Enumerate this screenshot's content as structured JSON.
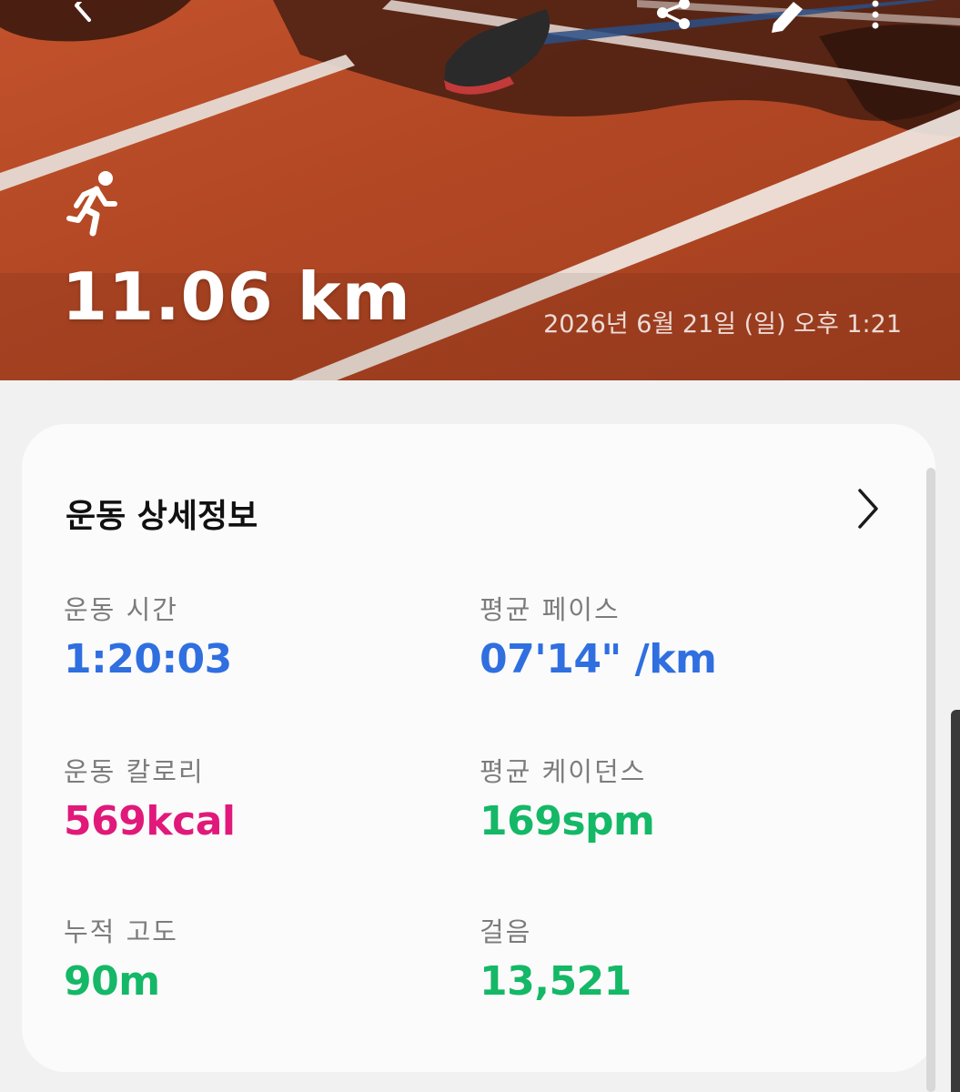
{
  "header": {
    "back_icon": "chevron-left-icon",
    "share_icon": "share-icon",
    "edit_icon": "pencil-icon",
    "more_icon": "more-vertical-icon",
    "activity_icon": "running-icon",
    "distance": "11.06 km",
    "datetime": "2026년 6월 21일 (일) 오후 1:21"
  },
  "details": {
    "title": "운동 상세정보",
    "chevron_icon": "chevron-right-icon",
    "stats": [
      {
        "label": "운동 시간",
        "value": "1:20:03",
        "color": "#2f6fe0"
      },
      {
        "label": "평균 페이스",
        "value": "07'14\" /km",
        "color": "#2f6fe0"
      },
      {
        "label": "운동 칼로리",
        "value": "569kcal",
        "color": "#e0197a"
      },
      {
        "label": "평균 케이던스",
        "value": "169spm",
        "color": "#14b866"
      },
      {
        "label": "누적 고도",
        "value": "90m",
        "color": "#14b866"
      },
      {
        "label": "걸음",
        "value": "13,521",
        "color": "#14b866"
      }
    ]
  }
}
